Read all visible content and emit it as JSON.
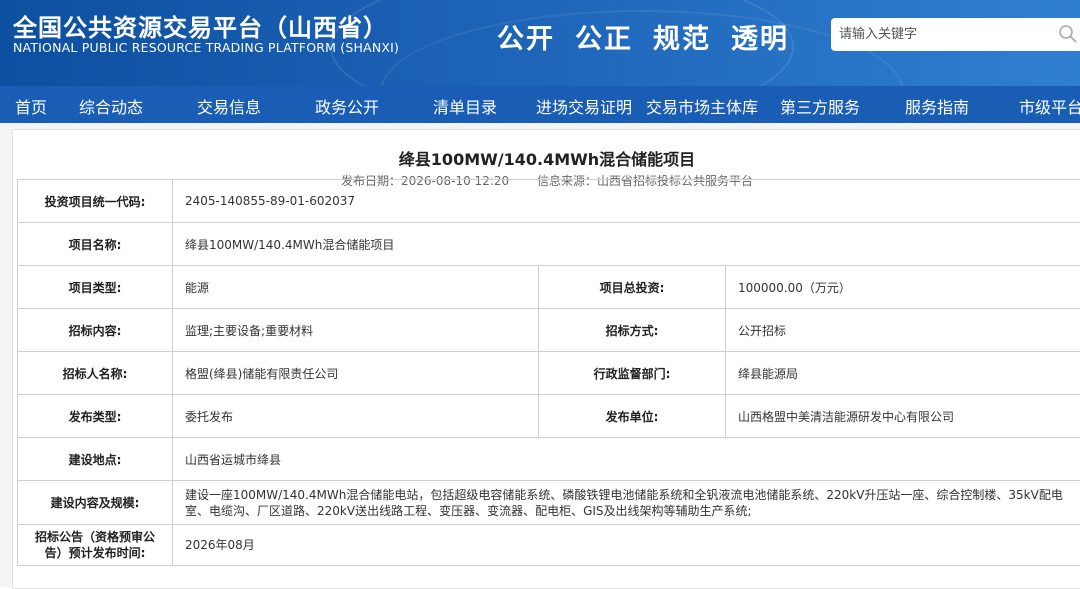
{
  "header": {
    "title": "全国公共资源交易平台（山西省）",
    "subtitle": "NATIONAL PUBLIC RESOURCE TRADING PLATFORM (SHANXI)",
    "slogans": [
      "公开",
      "公正",
      "规范",
      "透明"
    ],
    "search_placeholder": "请输入关键字"
  },
  "nav": {
    "items": [
      "首页",
      "综合动态",
      "交易信息",
      "政务公开",
      "清单目录",
      "进场交易证明",
      "交易市场主体库",
      "第三方服务",
      "服务指南",
      "市级平台"
    ]
  },
  "project": {
    "title": "绛县100MW/140.4MWh混合储能项目",
    "publish_date": "发布日期：2026-08-10 12:20",
    "source": "信息来源：山西省招标投标公共服务平台"
  },
  "details": {
    "code_label": "投资项目统一代码:",
    "code_value": "2405-140855-89-01-602037",
    "name_label": "项目名称:",
    "name_value": "绛县100MW/140.4MWh混合储能项目",
    "type_label": "项目类型:",
    "type_value": "能源",
    "investment_label": "项目总投资:",
    "investment_value": "100000.00（万元）",
    "content_label": "招标内容:",
    "content_value": "监理;主要设备;重要材料",
    "method_label": "招标方式:",
    "method_value": "公开招标",
    "tenderer_label": "招标人名称:",
    "tenderer_value": "格盟(绛县)储能有限责任公司",
    "supervisor_label": "行政监督部门:",
    "supervisor_value": "绛县能源局",
    "pubtype_label": "发布类型:",
    "pubtype_value": "委托发布",
    "publisher_label": "发布单位:",
    "publisher_value": "山西格盟中美清洁能源研发中心有限公司",
    "location_label": "建设地点:",
    "location_value": "山西省运城市绛县",
    "scale_label": "建设内容及规模:",
    "scale_value": "建设一座100MW/140.4MWh混合储能电站，包括超级电容储能系统、磷酸铁锂电池储能系统和全钒液流电池储能系统、220kV升压站一座、综合控制楼、35kV配电室、电缆沟、厂区道路、220kV送出线路工程、变压器、变流器、配电柜、GIS及出线架构等辅助生产系统;",
    "announce_label": "招标公告（资格预审公告）预计发布时间:",
    "announce_value": "2026年08月"
  }
}
